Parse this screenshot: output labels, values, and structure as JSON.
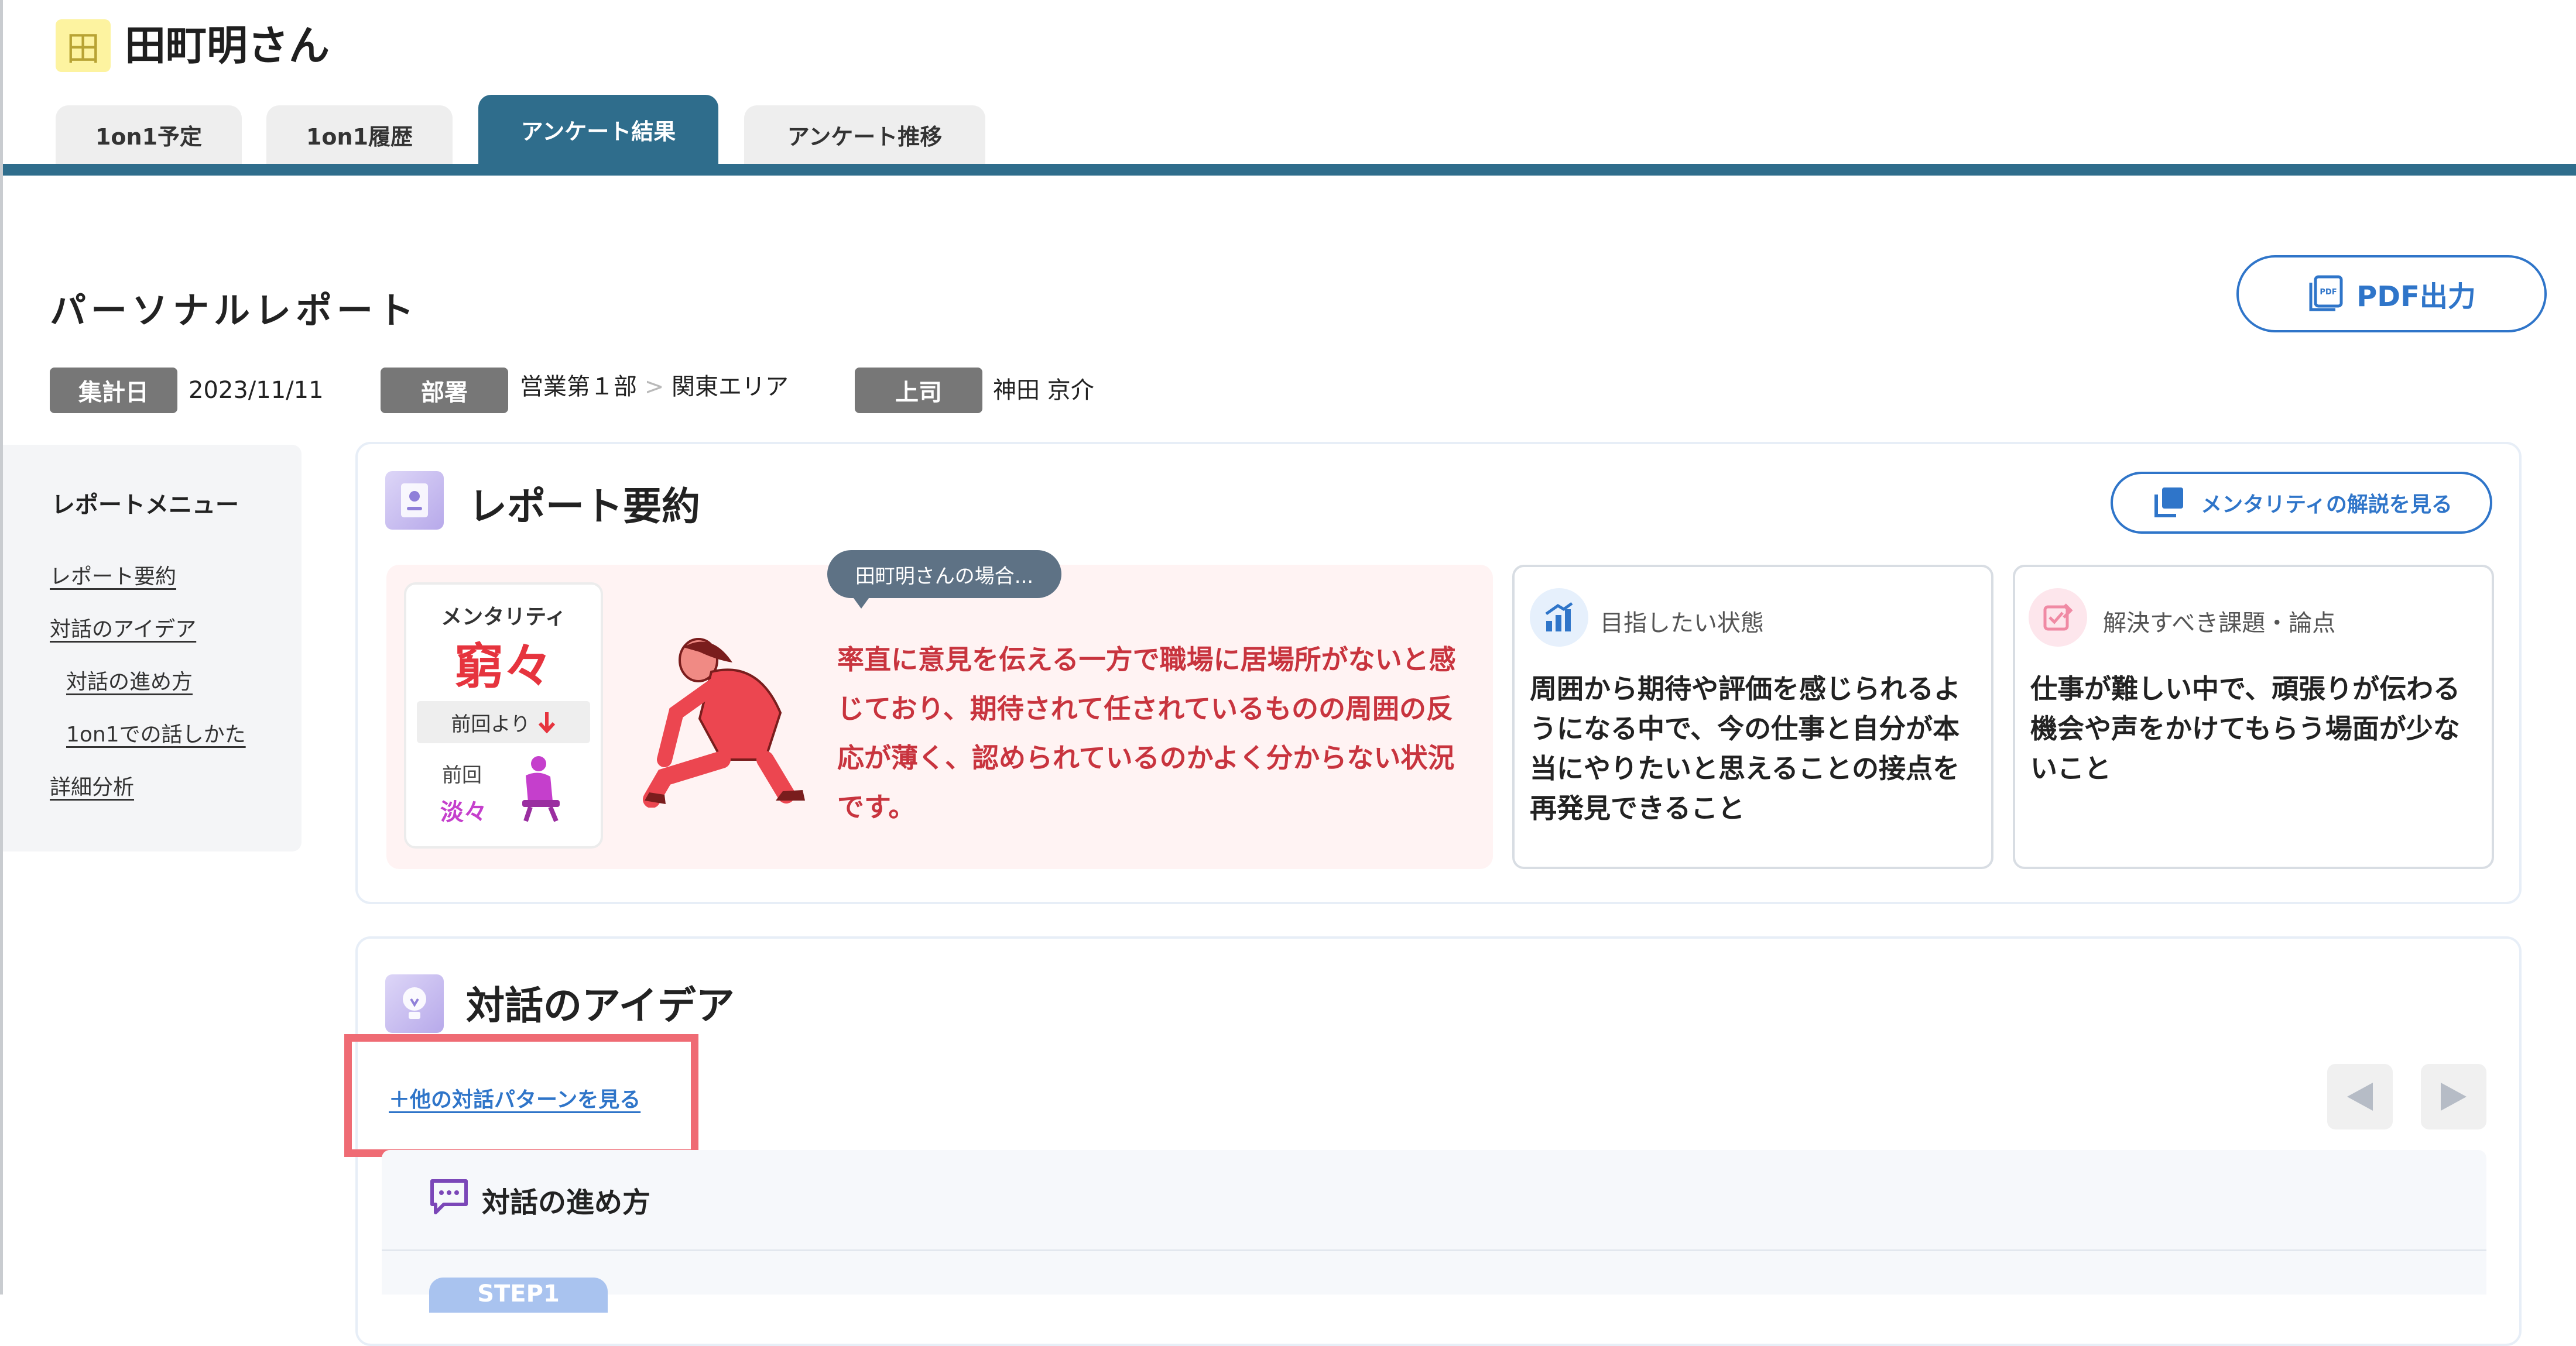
{
  "user": {
    "avatar_char": "田",
    "name": "田町明さん"
  },
  "tabs": [
    {
      "label": "1on1予定"
    },
    {
      "label": "1on1履歴"
    },
    {
      "label": "アンケート結果",
      "active": true
    },
    {
      "label": "アンケート推移"
    }
  ],
  "report": {
    "title": "パーソナルレポート",
    "pdf_button": "PDF出力",
    "meta": {
      "date_label": "集計日",
      "date_value": "2023/11/11",
      "dept_label": "部署",
      "dept_value": "営業第１部",
      "dept_sep": ">",
      "dept_sub": "関東エリア",
      "boss_label": "上司",
      "boss_value": "神田 京介"
    }
  },
  "menu": {
    "title": "レポートメニュー",
    "items": [
      "レポート要約",
      "対話のアイデア",
      "対話の進め方",
      "1on1での話しかた",
      "詳細分析"
    ]
  },
  "summary_section": {
    "title": "レポート要約",
    "explain_button": "メンタリティの解説を見る",
    "mentality_label": "メンタリティ",
    "mentality_value": "窮々",
    "prev_compare": "前回より",
    "prev_label": "前回",
    "prev_value": "淡々",
    "speech_bubble": "田町明さんの場合...",
    "summary_text": "率直に意見を伝える一方で職場に居場所がないと感じており、期待されて任されているものの周囲の反応が薄く、認められているのかよく分からない状況です。",
    "goal_title": "目指したい状態",
    "goal_text": " 周囲から期待や評価を感じられるようになる中で、今の仕事と自分が本当にやりたいと思えることの接点を再発見できること",
    "issue_title": "解決すべき課題・論点",
    "issue_text": "仕事が難しい中で、頑張りが伝わる機会や声をかけてもらう場面が少ないこと"
  },
  "dialog_section": {
    "title": "対話のアイデア",
    "other_patterns_link": "＋他の対話パターンを見る",
    "howto_title": "対話の進め方",
    "step_label": "STEP1"
  },
  "colors": {
    "primary": "#2f6d8c",
    "link": "#2f75c9",
    "alert": "#e6343e",
    "highlight": "#ef6b74"
  }
}
